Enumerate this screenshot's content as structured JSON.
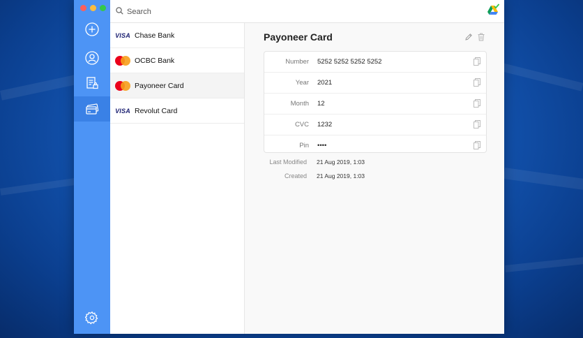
{
  "search": {
    "placeholder": "Search"
  },
  "cards": [
    {
      "brand": "visa",
      "brand_text": "VISA",
      "name": "Chase Bank"
    },
    {
      "brand": "mastercard",
      "name": "OCBC Bank"
    },
    {
      "brand": "mastercard",
      "name": "Payoneer Card",
      "selected": true
    },
    {
      "brand": "visa",
      "brand_text": "VISA",
      "name": "Revolut Card"
    }
  ],
  "detail": {
    "title": "Payoneer Card",
    "fields": [
      {
        "label": "Number",
        "value": "5252 5252 5252 5252"
      },
      {
        "label": "Year",
        "value": "2021"
      },
      {
        "label": "Month",
        "value": "12"
      },
      {
        "label": "CVC",
        "value": "1232"
      },
      {
        "label": "Pin",
        "value": "••••"
      }
    ],
    "meta": [
      {
        "label": "Last Modified",
        "value": "21 Aug 2019, 1:03"
      },
      {
        "label": "Created",
        "value": "21 Aug 2019, 1:03"
      }
    ]
  },
  "icons": {
    "sidebar": [
      "add-icon",
      "identity-icon",
      "secure-note-icon",
      "credit-card-icon",
      "settings-icon"
    ],
    "toolbar": [
      "search-icon",
      "sync-status-icon"
    ],
    "detail": [
      "edit-icon",
      "trash-icon",
      "copy-icon"
    ]
  },
  "colors": {
    "sidebar": "#4d94f5",
    "sidebar_active": "#3a81e6",
    "close": "#fc605c",
    "minimize": "#fdbc40",
    "zoom": "#34c84a",
    "mastercard_red": "#eb001b",
    "mastercard_orange": "#f79e1b",
    "visa_blue": "#1a1f71"
  }
}
